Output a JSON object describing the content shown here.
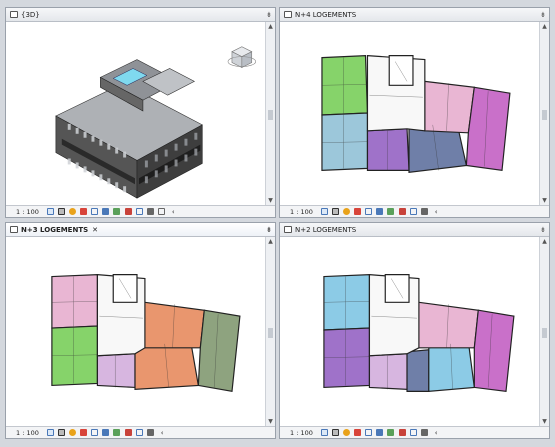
{
  "views": [
    {
      "title": "{3D}",
      "scale": "",
      "active": false,
      "closable": false
    },
    {
      "title": "N+4 LOGEMENTS",
      "scale": "1 : 100",
      "active": false,
      "closable": false
    },
    {
      "title": "N+3 LOGEMENTS",
      "scale": "1 : 100",
      "active": true,
      "closable": true
    },
    {
      "title": "N+2 LOGEMENTS",
      "scale": "1 : 100",
      "active": false,
      "closable": false
    }
  ],
  "view_3d_scale": "1 : 100",
  "close_glyph": "✕",
  "menu_glyph": "⇟",
  "chevron_glyph": "‹",
  "colors": {
    "green": "#86d36a",
    "teal": "#9cc7da",
    "purple": "#9f72c9",
    "slate": "#6f7fa8",
    "pink": "#e9b6d3",
    "magenta": "#c970c9",
    "salmon": "#e9966e",
    "lilac": "#d7b6e0",
    "sage": "#8ea37f",
    "blue": "#8ccbe6"
  },
  "statusbar_tools": [
    "view-cube-tool",
    "visual-style-tool",
    "sun-path-tool",
    "shadows-tool",
    "crop-tool",
    "show-crop-tool",
    "temp-hide-tool",
    "reveal-tool",
    "worksharing-tool",
    "analysis-tool",
    "highlight-tool",
    "design-options-tool"
  ]
}
